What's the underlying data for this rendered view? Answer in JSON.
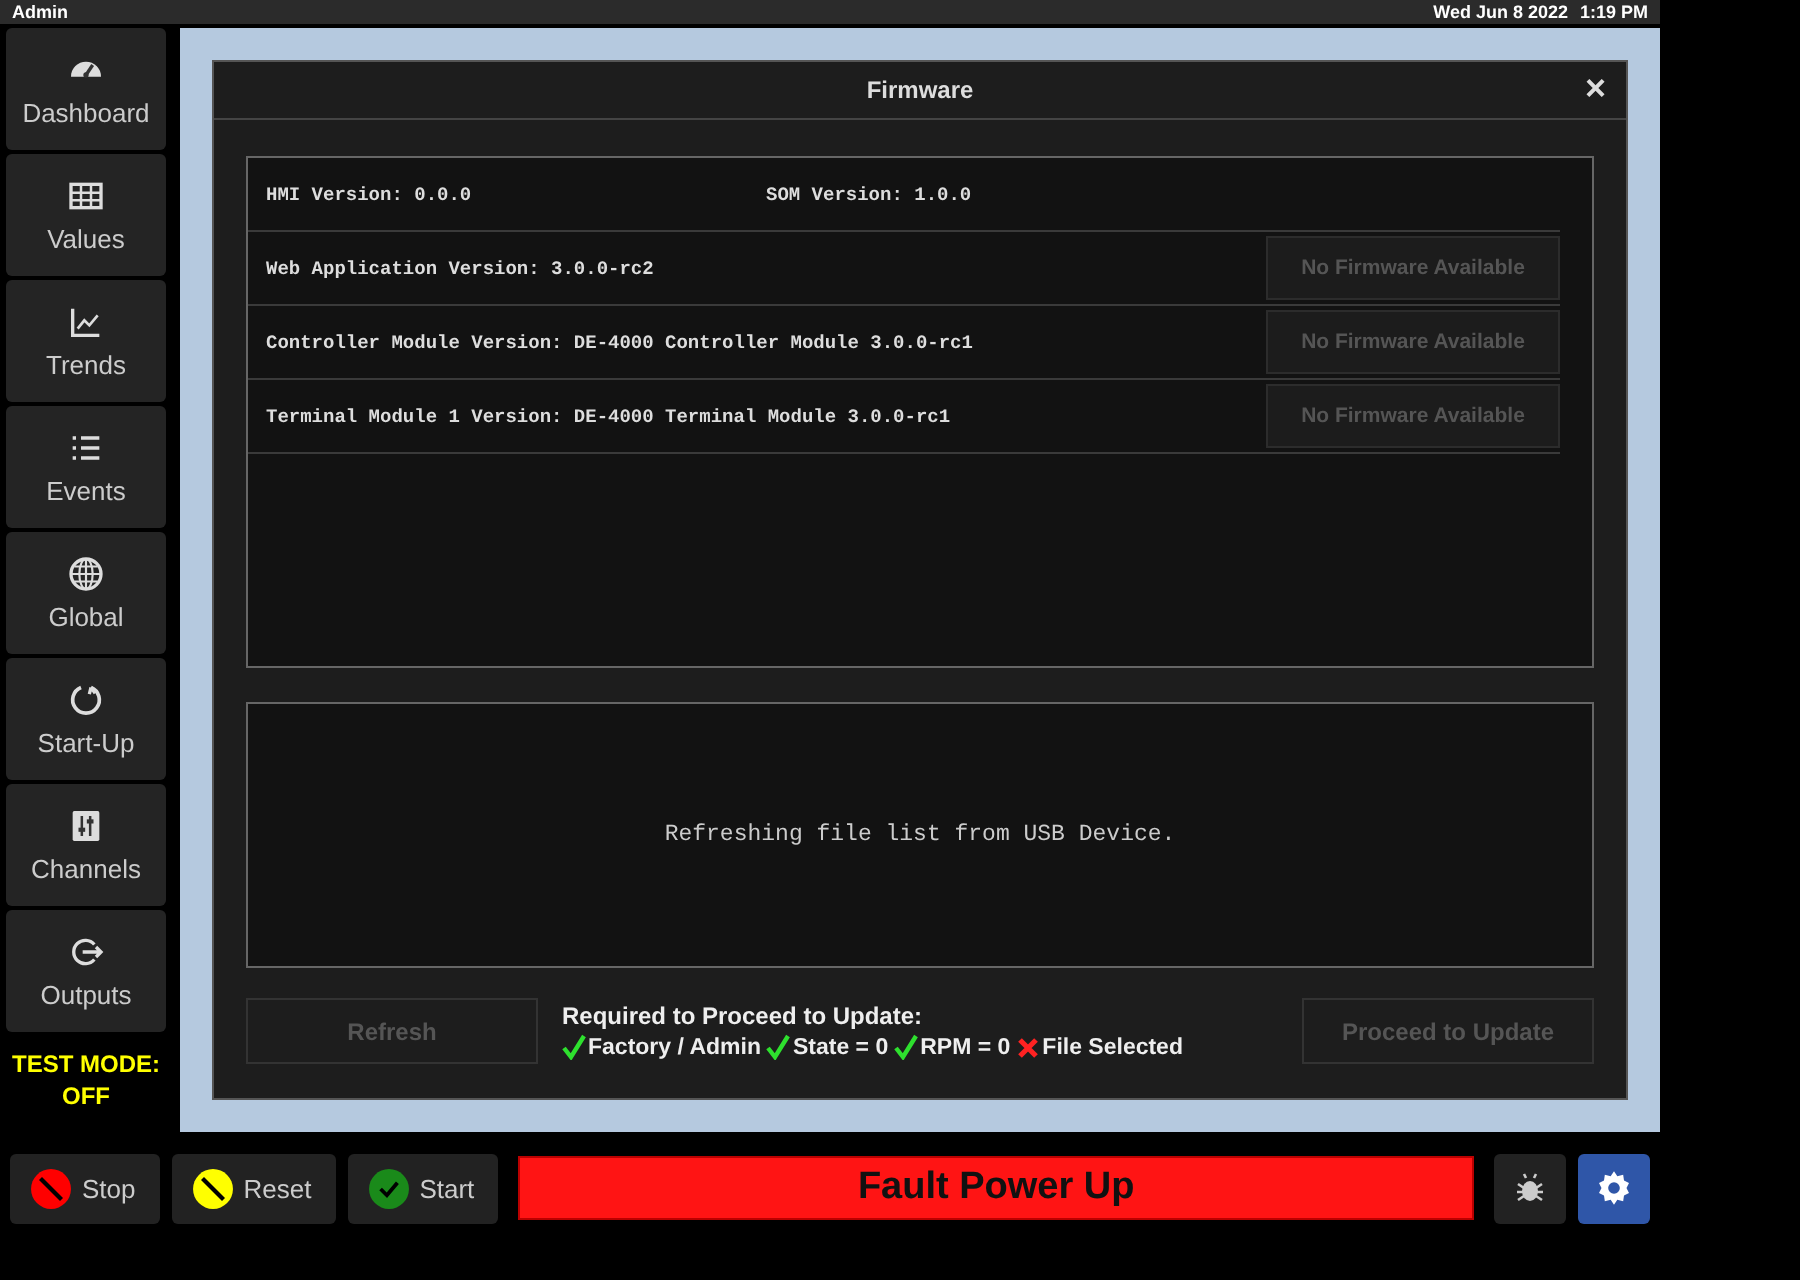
{
  "top_bar": {
    "user": "Admin",
    "date": "Wed Jun 8 2022",
    "time": "1:19 PM"
  },
  "sidebar": {
    "items": [
      {
        "label": "Dashboard"
      },
      {
        "label": "Values"
      },
      {
        "label": "Trends"
      },
      {
        "label": "Events"
      },
      {
        "label": "Global"
      },
      {
        "label": "Start-Up"
      },
      {
        "label": "Channels"
      },
      {
        "label": "Outputs"
      }
    ],
    "test_mode": "TEST MODE:\nOFF"
  },
  "dialog": {
    "title": "Firmware",
    "close": "×",
    "versions": [
      {
        "cells": [
          "HMI Version: 0.0.0",
          "SOM Version: 1.0.0"
        ]
      },
      {
        "cells": [
          "Web Application Version: 3.0.0-rc2"
        ],
        "action": {
          "label": "No Firmware Available",
          "disabled": true
        }
      },
      {
        "cells": [
          "Controller Module Version: DE-4000 Controller Module 3.0.0-rc1"
        ],
        "action": {
          "label": "No Firmware Available",
          "disabled": true
        }
      },
      {
        "cells": [
          "Terminal Module 1 Version: DE-4000 Terminal Module 3.0.0-rc1"
        ],
        "action": {
          "label": "No Firmware Available",
          "disabled": true
        }
      }
    ],
    "message": "Refreshing file list from USB Device.",
    "refresh": {
      "label": "Refresh",
      "disabled": true
    },
    "requirements_title": "Required to Proceed to Update:",
    "requirements": [
      {
        "label": "Factory / Admin",
        "met": true
      },
      {
        "label": "State = 0",
        "met": true
      },
      {
        "label": "RPM = 0",
        "met": true
      },
      {
        "label": "File Selected",
        "met": false
      }
    ],
    "proceed": {
      "label": "Proceed to Update",
      "disabled": true
    }
  },
  "bottom_bar": {
    "buttons": [
      {
        "label": "Stop",
        "kind": "stop"
      },
      {
        "label": "Reset",
        "kind": "reset"
      },
      {
        "label": "Start",
        "kind": "start"
      }
    ],
    "status": "Fault Power Up"
  }
}
